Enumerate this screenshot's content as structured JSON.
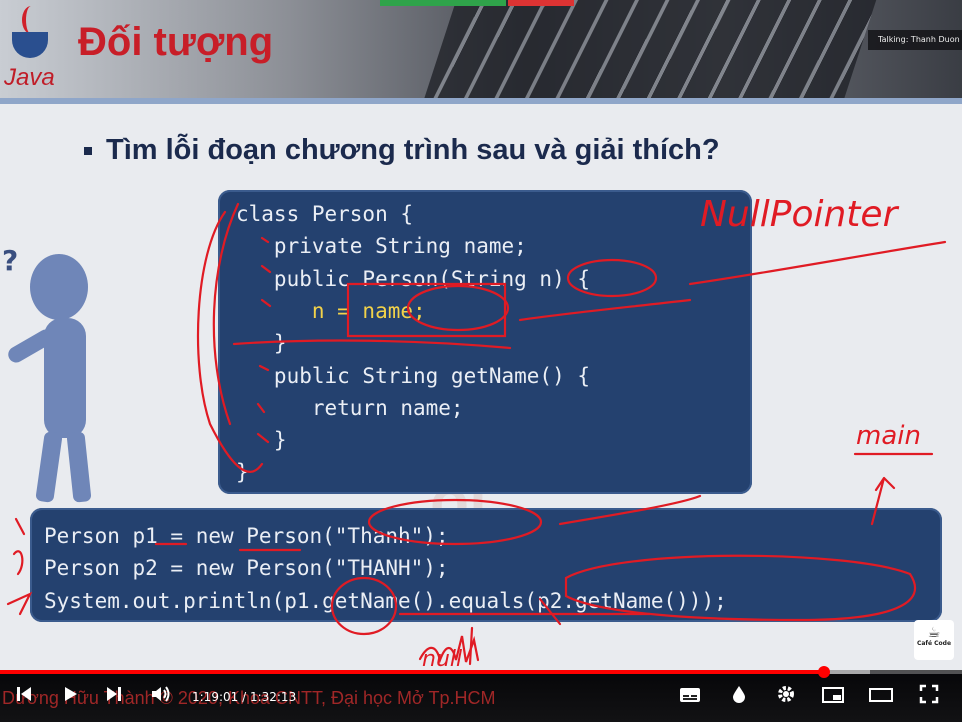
{
  "header": {
    "logo_text": "Java",
    "title": "Đối tượng",
    "talking": "Talking: Thanh Duon"
  },
  "slide": {
    "bullet": "Tìm lỗi đoạn chương trình sau và giải thích?",
    "code_class": [
      "class Person {",
      "   private String name;",
      "   public Person(String n) {",
      "      n = name;",
      "   }",
      "   public String getName() {",
      "      return name;",
      "   }",
      "}"
    ],
    "code_main": [
      "Person p1 = new Person(\"Thanh\");",
      "Person p2 = new Person(\"THANH\");",
      "System.out.println(p1.getName().equals(p2.getName()));"
    ],
    "annotations": {
      "top_right": "NullPointer",
      "right": "main",
      "bottom": "null"
    },
    "cafe_badge": "Café Code"
  },
  "player": {
    "current_time": "1:19:01",
    "duration": "1:32:13",
    "time_separator": " / ",
    "progress": 0.857,
    "footer_text": "Dương Hữu Thành © 2020, Khoa CNTT, Đại học Mở Tp.HCM",
    "accent_color": "#ff0000",
    "icons": [
      "skip-back-icon",
      "play-icon",
      "skip-next-icon",
      "volume-icon",
      "subtitles-icon",
      "ambient-icon",
      "settings-icon",
      "miniplayer-icon",
      "theater-icon",
      "fullscreen-icon"
    ]
  }
}
